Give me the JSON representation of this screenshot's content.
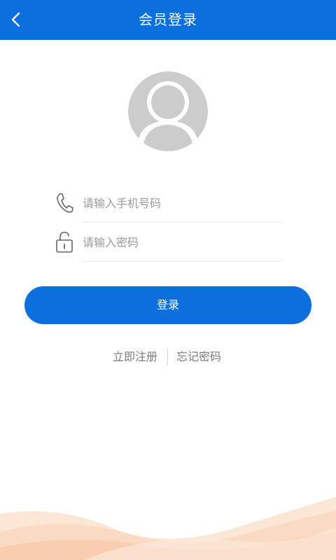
{
  "header": {
    "title": "会员登录",
    "back_icon": "chevron-left-icon",
    "background": "#0b6fdd"
  },
  "avatar": {
    "icon": "user-avatar-placeholder-icon",
    "color": "#cccccc"
  },
  "form": {
    "phone": {
      "icon": "phone-icon",
      "placeholder": "请输入手机号码",
      "value": ""
    },
    "password": {
      "icon": "lock-icon",
      "placeholder": "请输入密码",
      "value": ""
    }
  },
  "login_button": {
    "label": "登录",
    "color": "#0b6fdd"
  },
  "links": {
    "register": "立即注册",
    "forgot": "忘记密码"
  },
  "decoration": {
    "wave_color": "#f8c9a8"
  }
}
